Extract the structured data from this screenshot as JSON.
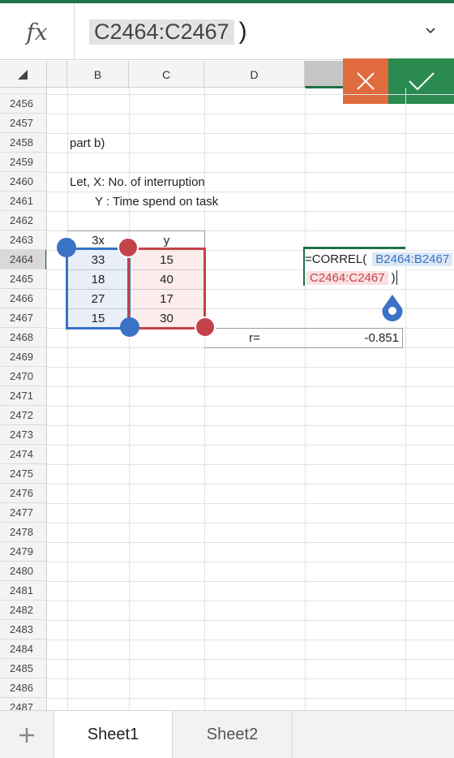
{
  "formula_bar": {
    "fx_label": "fx",
    "range_text": "C2464:C2467",
    "close_paren": ")",
    "expand_icon": "chevron-down-icon"
  },
  "columns": [
    "B",
    "C",
    "D"
  ],
  "selected_column": "E",
  "rows": [
    "2456",
    "2457",
    "2458",
    "2459",
    "2460",
    "2461",
    "2462",
    "2463",
    "2464",
    "2465",
    "2466",
    "2467",
    "2468",
    "2469",
    "2470",
    "2471",
    "2472",
    "2473",
    "2474",
    "2475",
    "2476",
    "2477",
    "2478",
    "2479",
    "2480",
    "2481",
    "2482",
    "2483",
    "2484",
    "2485",
    "2486",
    "2487"
  ],
  "selected_row": "2464",
  "cells": {
    "b2458": "part b)",
    "b2460": "Let, X: No. of interruption",
    "b2461": "Y : Time spend on task",
    "b2463": "3x",
    "c2463": "y",
    "x_values": [
      "33",
      "18",
      "27",
      "15"
    ],
    "y_values": [
      "15",
      "40",
      "17",
      "30"
    ],
    "d2468": "r=",
    "e2468": "-0.851"
  },
  "formula_edit": {
    "prefix": "=CORREL(",
    "range_b": "B2464:B2467",
    "comma": ",",
    "range_c": "C2464:C2467",
    "close_paren": ")"
  },
  "actions": {
    "cancel_icon": "close-icon",
    "confirm_icon": "checkmark-icon"
  },
  "tabs": {
    "add_icon": "plus-icon",
    "sheet1": "Sheet1",
    "sheet2": "Sheet2",
    "active": "Sheet1"
  },
  "colors": {
    "accent_green": "#1e7145",
    "range_blue": "#3a72c6",
    "range_red": "#c3434a",
    "cancel_orange": "#e06b3f",
    "confirm_green": "#2a8a4f"
  }
}
